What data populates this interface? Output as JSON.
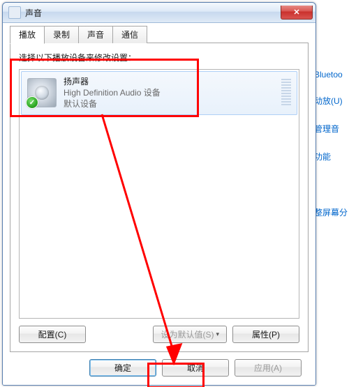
{
  "window": {
    "title": "声音",
    "close_glyph": "✕"
  },
  "tabs": [
    {
      "label": "播放",
      "active": true
    },
    {
      "label": "录制",
      "active": false
    },
    {
      "label": "声音",
      "active": false
    },
    {
      "label": "通信",
      "active": false
    }
  ],
  "instruction": "选择以下播放设备来修改设置：",
  "device": {
    "name": "扬声器",
    "subtitle": "High Definition Audio 设备",
    "status": "默认设备",
    "check_glyph": "✓"
  },
  "page_buttons": {
    "configure": "配置(C)",
    "set_default": "设为默认值(S)",
    "caret": "▾",
    "properties": "属性(P)"
  },
  "footer": {
    "ok": "确定",
    "cancel": "取消",
    "apply": "应用(A)"
  },
  "bg_links": {
    "a": "Bluetoo",
    "b": "动放(U)",
    "c": "管理音",
    "d": "功能",
    "e": "整屏幕分"
  }
}
